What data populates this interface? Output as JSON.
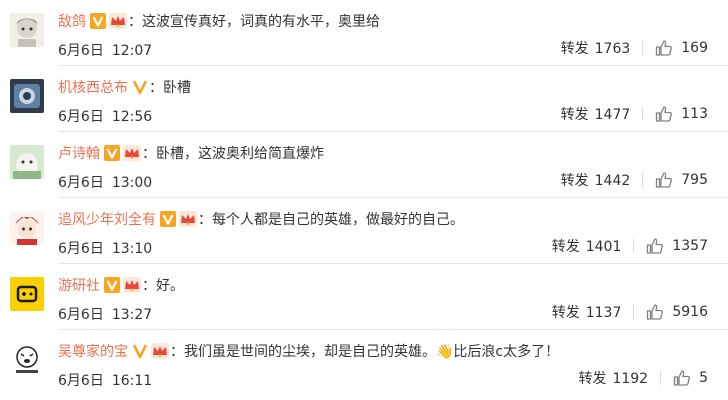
{
  "labels": {
    "repost": "转发"
  },
  "colors": {
    "nickname": "#eb7350",
    "vip_badge": "#f6a623",
    "crown": "#e8483c"
  },
  "comments": [
    {
      "nickname": "敌鸽",
      "vip": true,
      "crown": true,
      "text": "这波宣传真好，词真的有水平，奥里给",
      "date": "6月6日",
      "time": "12:07",
      "reposts": "1763",
      "likes": "169"
    },
    {
      "nickname": "机核西总布",
      "vip": true,
      "crown": false,
      "text": "卧槽",
      "date": "6月6日",
      "time": "12:56",
      "reposts": "1477",
      "likes": "113"
    },
    {
      "nickname": "卢诗翰",
      "vip": true,
      "crown": true,
      "text": "卧槽，这波奥利给简直爆炸",
      "date": "6月6日",
      "time": "13:00",
      "reposts": "1442",
      "likes": "795"
    },
    {
      "nickname": "追风少年刘全有",
      "vip": true,
      "crown": true,
      "text": "每个人都是自己的英雄，做最好的自己。",
      "date": "6月6日",
      "time": "13:10",
      "reposts": "1401",
      "likes": "1357"
    },
    {
      "nickname": "游研社",
      "vip": true,
      "crown": true,
      "text": "好。",
      "date": "6月6日",
      "time": "13:27",
      "reposts": "1137",
      "likes": "5916"
    },
    {
      "nickname": "吴尊家的宝",
      "vip": true,
      "crown": true,
      "text": "我们虽是世间的尘埃，却是自己的英雄。👋比后浪c太多了！",
      "date": "6月6日",
      "time": "16:11",
      "reposts": "1192",
      "likes": "5"
    }
  ]
}
